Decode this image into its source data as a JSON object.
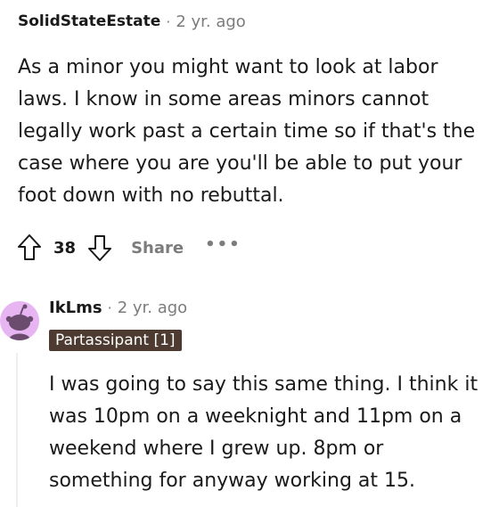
{
  "top_comment": {
    "author": "SolidStateEstate",
    "separator": "·",
    "time": "2 yr. ago",
    "body": "As a minor you might want to look at labor laws. I know in some areas minors cannot legally work past a certain time so if that's the case where you are you'll be able to put your foot down with no rebuttal.",
    "actions": {
      "upvote_icon": "upvote-arrow-icon",
      "vote_count": "38",
      "downvote_icon": "downvote-arrow-icon",
      "share_label": "Share",
      "more_label": "•••"
    }
  },
  "reply": {
    "avatar_icon": "reddit-snoo-avatar",
    "author": "IkLms",
    "separator": "·",
    "time": "2 yr. ago",
    "flair": "Partassipant [1]",
    "body": "I was going to say this same thing. I think it was 10pm on a weeknight and 11pm on a weekend where I grew up. 8pm or something for anyway working at 15."
  },
  "colors": {
    "text": "#1a1a1b",
    "muted": "#7c7c7c",
    "flair_bg": "#4d3b31",
    "avatar_bg": "#e7b6f2",
    "thread_line": "#edeff1"
  }
}
